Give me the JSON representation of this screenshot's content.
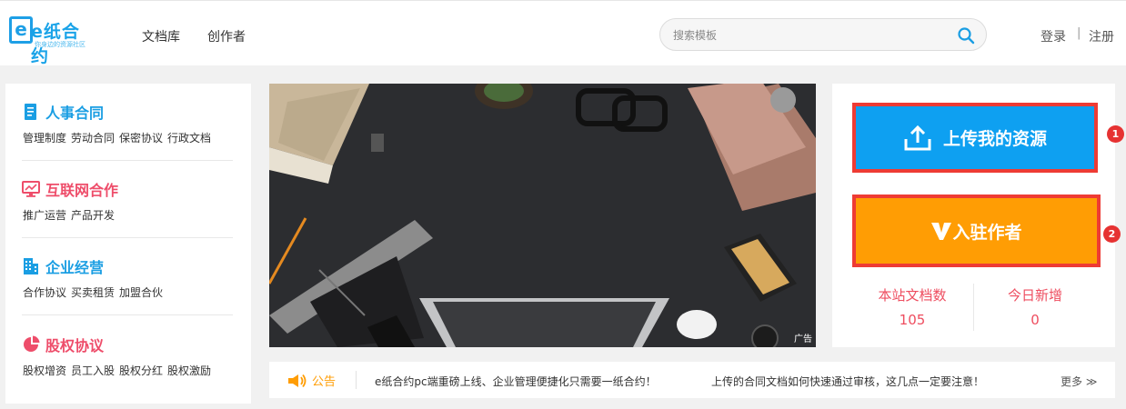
{
  "header": {
    "logo_name": "e纸合约",
    "logo_tagline": "你身边的资源社区",
    "nav": [
      "文档库",
      "创作者"
    ],
    "search_placeholder": "搜索模板",
    "login": "登录",
    "separator": "|",
    "register": "注册"
  },
  "categories": [
    {
      "title": "人事合同",
      "color": "#1a9ee3",
      "icon": "document-icon",
      "links": [
        "管理制度",
        "劳动合同",
        "保密协议",
        "行政文档"
      ]
    },
    {
      "title": "互联网合作",
      "color": "#ee4d6a",
      "icon": "monitor-icon",
      "links": [
        "推广运营",
        "产品开发"
      ]
    },
    {
      "title": "企业经营",
      "color": "#1a9ee3",
      "icon": "building-icon",
      "links": [
        "合作协议",
        "买卖租赁",
        "加盟合伙"
      ]
    },
    {
      "title": "股权协议",
      "color": "#ee4d6a",
      "icon": "pie-chart-icon",
      "links": [
        "股权增资",
        "员工入股",
        "股权分红",
        "股权激励"
      ]
    }
  ],
  "banner": {
    "ad_label": "广告"
  },
  "actions": {
    "upload_label": "上传我的资源",
    "upload_marker": "1",
    "author_label": "入驻作者",
    "author_marker": "2"
  },
  "stats": {
    "total_label": "本站文档数",
    "total_value": "105",
    "today_label": "今日新增",
    "today_value": "0"
  },
  "notice": {
    "label": "公告",
    "items": [
      "e纸合约pc端重磅上线、企业管理便捷化只需要一纸合约！",
      "上传的合同文档如何快速通过审核，这几点一定要注意！"
    ],
    "more": "更多 ≫"
  },
  "colors": {
    "brand_blue": "#0ea0f1",
    "author_orange": "#ff9d04",
    "highlight_red": "#ee3b34",
    "stat_pink": "#ee4d5f"
  }
}
